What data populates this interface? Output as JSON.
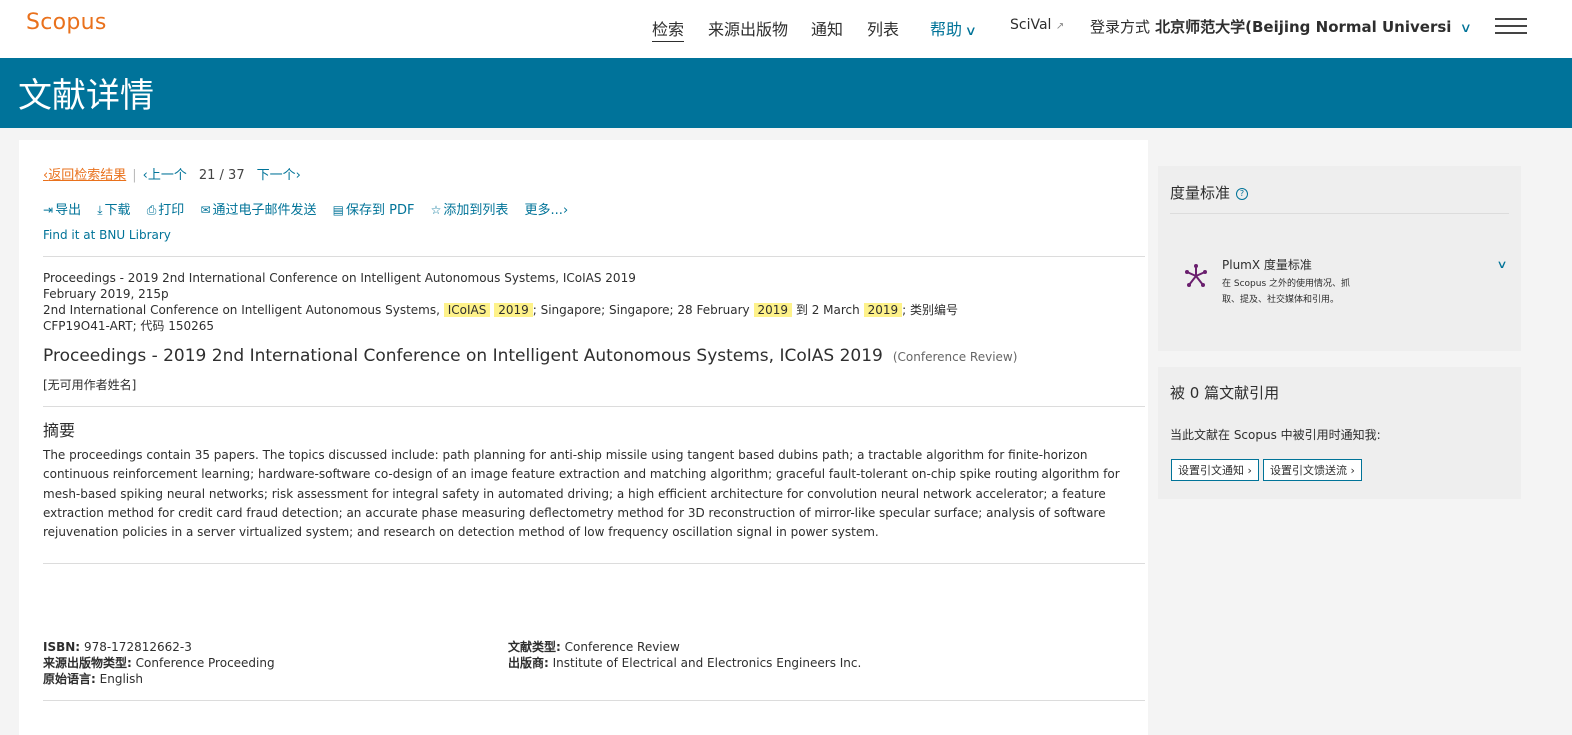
{
  "nav": {
    "logo": "Scopus",
    "search": "检索",
    "sources": "来源出版物",
    "alerts": "通知",
    "lists": "列表",
    "help": "帮助",
    "scival": "SciVal",
    "login_label": "登录方式",
    "institution": "北京师范大学(Beijing Normal Universi"
  },
  "banner": {
    "title": "文献详情"
  },
  "result_nav": {
    "back": "返回检索结果",
    "prev": "上一个",
    "position": "21",
    "slash": "/",
    "total": "37",
    "next": "下一个"
  },
  "toolbar": {
    "export": "导出",
    "download": "下载",
    "print": "打印",
    "email": "通过电子邮件发送",
    "pdf": "保存到 PDF",
    "add_list": "添加到列表",
    "more": "更多..."
  },
  "findit": "Find it at BNU Library",
  "source": {
    "line1": "Proceedings - 2019 2nd International Conference on Intelligent Autonomous Systems, ICoIAS 2019",
    "line2": "February 2019, 215p",
    "line3_a": "2nd International Conference on Intelligent Autonomous Systems,",
    "hl1": "ICoIAS",
    "hl2": "2019",
    "line3_b": "; Singapore; Singapore; 28 February",
    "hl3": "2019",
    "line3_c": "到 2 March",
    "hl4": "2019",
    "line3_d": "; 类别编号CFP19O41-ART; 代码 150265"
  },
  "document": {
    "title": "Proceedings - 2019 2nd International Conference on Intelligent Autonomous Systems, ICoIAS 2019",
    "type": "(Conference Review)",
    "authors": "[无可用作者姓名]"
  },
  "abstract": {
    "heading": "摘要",
    "text": "The proceedings contain 35 papers. The topics discussed include: path planning for anti-ship missile using tangent based dubins path; a tractable algorithm for finite-horizon continuous reinforcement learning; hardware-software co-design of an image feature extraction and matching algorithm; graceful fault-tolerant on-chip spike routing algorithm for mesh-based spiking neural networks; risk assessment for integral safety in automated driving; a high efficient architecture for convolution neural network accelerator; a feature extraction method for credit card fraud detection; an accurate phase measuring deflectometry method for 3D reconstruction of mirror-like specular surface; analysis of software rejuvenation policies in a server virtualized system; and research on detection method of low frequency oscillation signal in power system."
  },
  "meta": {
    "isbn_label": "ISBN:",
    "isbn": "978-172812662-3",
    "source_type_label": "来源出版物类型:",
    "source_type": "Conference Proceeding",
    "language_label": "原始语言:",
    "language": "English",
    "doc_type_label": "文献类型:",
    "doc_type": "Conference Review",
    "publisher_label": "出版商:",
    "publisher": "Institute of Electrical and Electronics Engineers Inc."
  },
  "sidebar": {
    "metrics_title": "度量标准",
    "plumx_title": "PlumX 度量标准",
    "plumx_desc": "在 Scopus 之外的使用情况、抓取、提及、社交媒体和引用。",
    "cited_title": "被 0 篇文献引用",
    "notify_text": "当此文献在 Scopus 中被引用时通知我:",
    "btn_alert": "设置引文通知",
    "btn_feed": "设置引文馈送流"
  },
  "colors": {
    "brand_orange": "#e9711c",
    "banner_teal": "#00739a",
    "link_blue": "#007398",
    "highlight": "#fef28a",
    "plumx_purple": "#6a1f6e"
  }
}
